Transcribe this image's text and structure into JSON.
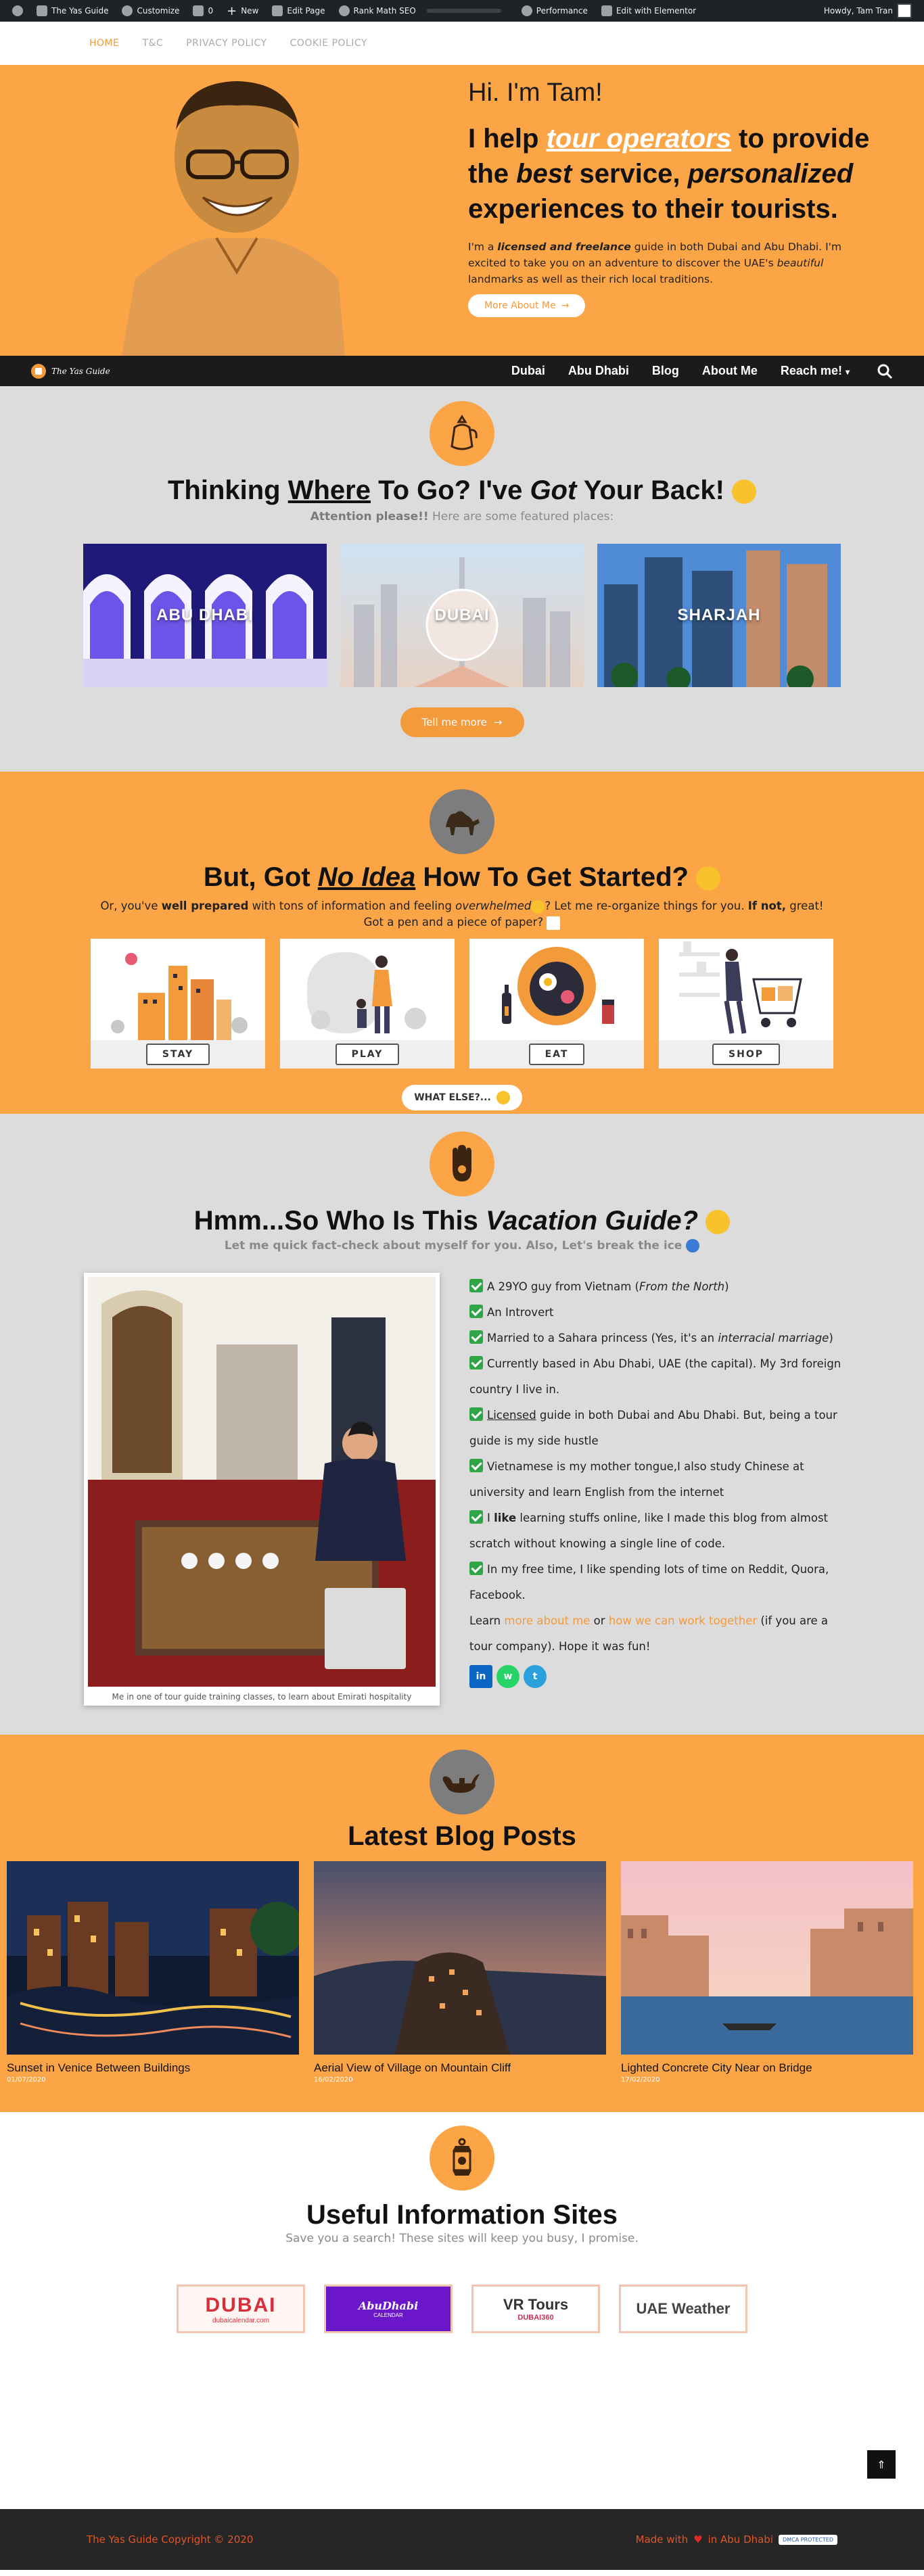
{
  "adminbar": {
    "site_name": "The Yas Guide",
    "customize": "Customize",
    "comments_count": "0",
    "new": "New",
    "edit_page": "Edit Page",
    "rank_math": "Rank Math SEO",
    "performance": "Performance",
    "elementor": "Edit with Elementor",
    "howdy": "Howdy, Tam Tran"
  },
  "toplinks": [
    "HOME",
    "T&C",
    "PRIVACY POLICY",
    "COOKIE POLICY"
  ],
  "hero": {
    "hi": "Hi. I'm Tam!",
    "lead_1": "I help ",
    "lead_hl": "tour operators",
    "lead_2": " to provide the ",
    "lead_best": "best",
    "lead_3": " service, ",
    "lead_pers": "personalized",
    "lead_4": " experiences to their tourists.",
    "desc_1": "I'm a ",
    "desc_bold": "licensed and freelance",
    "desc_2": " guide in both Dubai and Abu Dhabi. I'm excited to take you on an adventure to discover the UAE's ",
    "desc_beautiful": "beautiful",
    "desc_3": " landmarks as well as their rich local traditions.",
    "button": "More About Me"
  },
  "nav": {
    "brand": "The Yas Guide",
    "items": [
      "Dubai",
      "Abu Dhabi",
      "Blog",
      "About Me",
      "Reach me!"
    ]
  },
  "where": {
    "title_1": "Thinking ",
    "title_where": "Where",
    "title_2": " To Go? I've ",
    "title_got": "Got",
    "title_3": " Your Back!",
    "sub_bold": "Attention please!!",
    "sub_rest": " Here are some featured places:",
    "places": [
      "ABU DHABI",
      "DUBAI",
      "SHARJAH"
    ],
    "button": "Tell me more"
  },
  "started": {
    "title_1": "But, Got ",
    "title_idea": "No Idea",
    "title_2": " How To Get Started?",
    "line_1": "Or, you've ",
    "line_bold": "well prepared",
    "line_2": " with tons of information and feeling ",
    "line_italic": "overwhelmed",
    "line_3": "? Let me re-organize things for you. ",
    "line_bold2": "If not,",
    "line_4": " great!",
    "line_5": "Got a pen and a piece of paper?",
    "cards": [
      "STAY",
      "PLAY",
      "EAT",
      "SHOP"
    ],
    "what_else": "WHAT ELSE?..."
  },
  "who": {
    "title_1": "Hmm...So Who Is This ",
    "title_italic": "Vacation Guide?",
    "sub": "Let me quick fact-check about myself for you. Also, Let's break the ice",
    "caption": "Me in one of tour guide training classes, to learn about Emirati hospitality",
    "facts": {
      "f1_a": "A 29YO guy from Vietnam (",
      "f1_i": "From the North",
      "f1_b": ")",
      "f2": "An Introvert",
      "f3_a": "Married to a Sahara princess (Yes, it's an ",
      "f3_i": "interracial marriage",
      "f3_b": ")",
      "f4": "Currently based in Abu Dhabi, UAE (the capital). My 3rd foreign country I live in.",
      "f5_u": "Licensed",
      "f5_b": " guide in both Dubai and Abu Dhabi. But, being a tour guide is my side hustle",
      "f6": "Vietnamese is my mother tongue,I also study Chinese at university and learn English from the internet",
      "f7_a": "I ",
      "f7_b": "like",
      "f7_c": " learning stuffs online, like I made this blog from almost scratch without knowing a single line of code.",
      "f8": "In my free time, I like spending lots of time on Reddit, Quora, Facebook.",
      "learn_1": "Learn ",
      "learn_link1": "more about me",
      "learn_2": " or ",
      "learn_link2": "how we can work together",
      "learn_3": " (if you are a tour company). Hope it was fun!"
    },
    "socials": [
      "in",
      "w",
      "t"
    ]
  },
  "blog": {
    "title": "Latest Blog Posts",
    "posts": [
      {
        "title": "Sunset in Venice Between Buildings",
        "date": "01/07/2020"
      },
      {
        "title": "Aerial View of Village on Mountain Cliff",
        "date": "16/02/2020"
      },
      {
        "title": "Lighted Concrete City Near on Bridge",
        "date": "17/02/2020"
      }
    ]
  },
  "useful": {
    "title": "Useful Information Sites",
    "sub": "Save you a search! These sites will keep you busy, I promise.",
    "sites": [
      {
        "main": "DUBAI",
        "small": "dubaicalendar.com"
      },
      {
        "main": "AbuDhabi",
        "small": "CALENDAR"
      },
      {
        "main": "VR Tours",
        "small": "DUBAI360"
      },
      {
        "main": "UAE Weather",
        "small": ""
      }
    ]
  },
  "footer": {
    "copyright": "The Yas Guide Copyright © 2020",
    "made_1": "Made with",
    "made_2": "in Abu Dhabi",
    "badge": "DMCA PROTECTED"
  },
  "colors": {
    "orange": "#fba546",
    "accent": "#f39a3b",
    "dark": "#1b1b1b",
    "gray": "#dcdcdc"
  }
}
